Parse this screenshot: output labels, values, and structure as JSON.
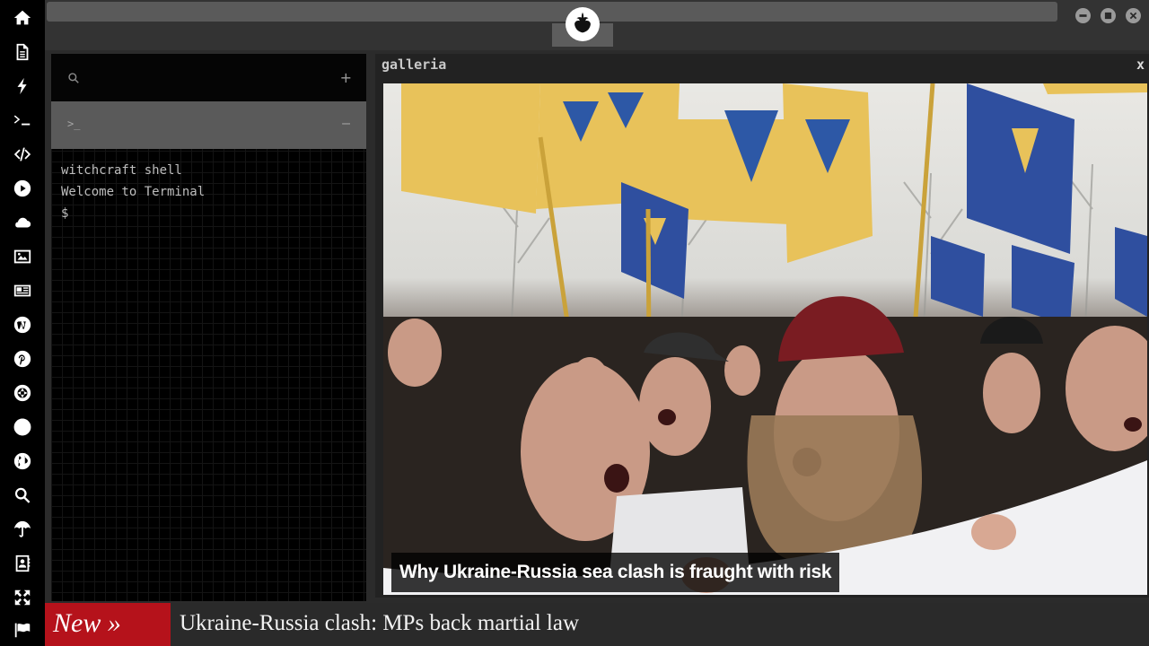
{
  "sidebar": {
    "icons": [
      "home-icon",
      "document-icon",
      "lightning-icon",
      "terminal-icon",
      "code-icon",
      "play-icon",
      "cloud-icon",
      "image-icon",
      "newspaper-icon",
      "wordpress-icon",
      "pinterest-icon",
      "aperture-icon",
      "globe-wire-icon",
      "earth-icon",
      "search-icon",
      "umbrella-icon",
      "contact-icon",
      "expand-icon",
      "flag-icon"
    ]
  },
  "topbar": {
    "logo": "rebel-alliance-icon",
    "window_controls": [
      "minimize",
      "maximize",
      "close"
    ]
  },
  "terminal": {
    "add_label": "+",
    "tab_prompt": ">_",
    "collapse_label": "–",
    "lines": [
      "witchcraft shell",
      "Welcome to Terminal",
      "$"
    ]
  },
  "galleria": {
    "title": "galleria",
    "close_label": "x",
    "caption": "Why Ukraine-Russia sea clash is fraught with risk"
  },
  "ticker": {
    "label": "New »",
    "headline": "Ukraine-Russia clash: MPs back martial law"
  }
}
